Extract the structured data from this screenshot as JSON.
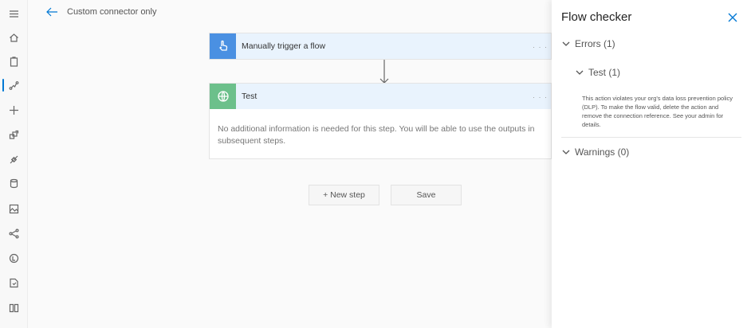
{
  "rail": {
    "items": [
      {
        "icon": "hamburger-menu-icon"
      },
      {
        "icon": "home-icon"
      },
      {
        "icon": "clipboard-icon"
      },
      {
        "icon": "flow-icon",
        "active": true
      },
      {
        "icon": "plus-icon"
      },
      {
        "icon": "templates-icon"
      },
      {
        "icon": "connectors-icon"
      },
      {
        "icon": "database-icon"
      },
      {
        "icon": "ai-image-icon"
      },
      {
        "icon": "process-icon"
      },
      {
        "icon": "coin-icon"
      },
      {
        "icon": "solutions-icon"
      },
      {
        "icon": "learn-book-icon"
      }
    ]
  },
  "header": {
    "flow_name": "Custom connector only"
  },
  "canvas": {
    "trigger_card": {
      "title": "Manually trigger a flow",
      "icon": "hand-pointer-icon",
      "menu": "· · ·"
    },
    "action_card": {
      "title": "Test",
      "icon": "globe-icon",
      "menu": "· · ·",
      "body": "No additional information is needed for this step. You will be able to use the outputs in subsequent steps."
    },
    "new_step_label": "+ New step",
    "save_label": "Save"
  },
  "flow_checker": {
    "title": "Flow checker",
    "errors_label": "Errors (1)",
    "error_item_label": "Test (1)",
    "error_message": "This action violates your org's data loss prevention policy (DLP). To make the flow valid, delete the action and remove the connection reference. See your admin for details.",
    "warnings_label": "Warnings (0)"
  },
  "colors": {
    "accent": "#0078d4",
    "trigger_icon_bg": "#4a90e2",
    "action_icon_bg": "#6cc08b",
    "card_header_bg": "#e9f3fd"
  }
}
